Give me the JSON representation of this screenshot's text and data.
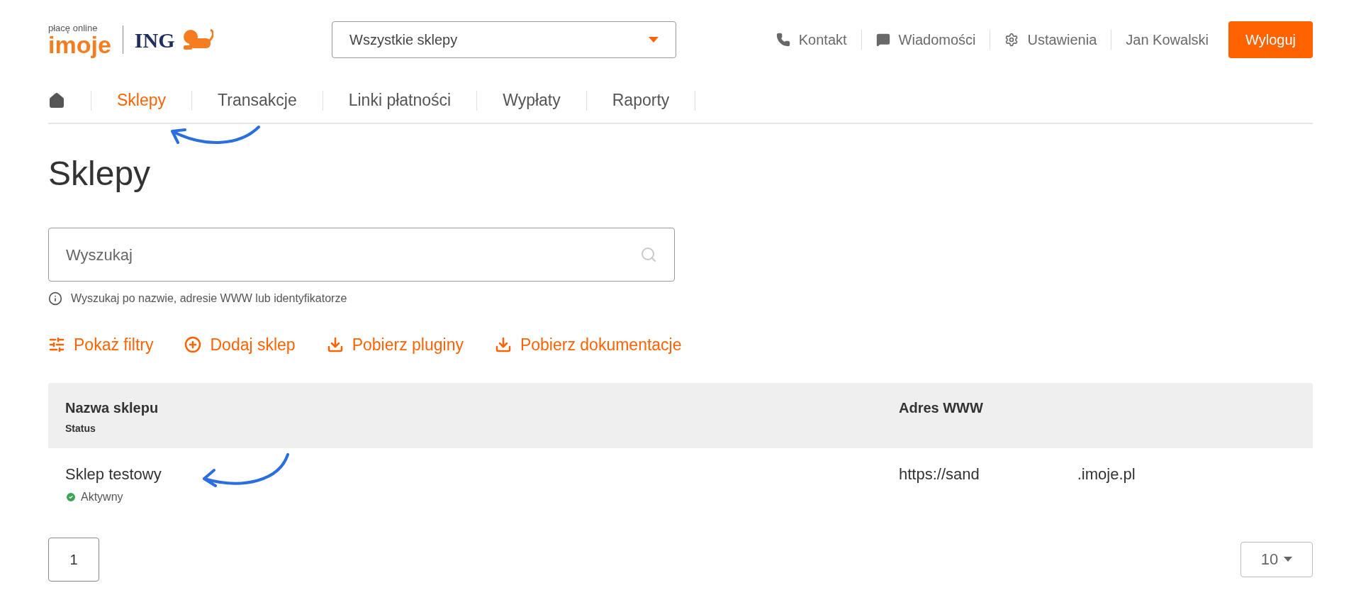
{
  "logo": {
    "tagline": "płacę online",
    "wordmark": "imoje",
    "bank": "ING"
  },
  "shop_select": {
    "value": "Wszystkie sklepy"
  },
  "top_links": [
    {
      "kind": "phone",
      "label": "Kontakt"
    },
    {
      "kind": "message",
      "label": "Wiadomości"
    },
    {
      "kind": "gear",
      "label": "Ustawienia"
    },
    {
      "kind": "user",
      "label": "Jan Kowalski"
    }
  ],
  "logout_button": "Wyloguj",
  "nav": [
    {
      "kind": "home",
      "selected": false
    },
    {
      "kind": "text",
      "label": "Sklepy",
      "selected": true
    },
    {
      "kind": "text",
      "label": "Transakcje",
      "selected": false
    },
    {
      "kind": "text",
      "label": "Linki płatności",
      "selected": false
    },
    {
      "kind": "text",
      "label": "Wypłaty",
      "selected": false
    },
    {
      "kind": "text",
      "label": "Raporty",
      "selected": false
    }
  ],
  "page_title": "Sklepy",
  "search": {
    "placeholder": "Wyszukaj",
    "hint": "Wyszukaj po nazwie, adresie WWW lub identyfikatorze"
  },
  "actions": [
    {
      "kind": "filters",
      "label": "Pokaż filtry"
    },
    {
      "kind": "add",
      "label": "Dodaj sklep"
    },
    {
      "kind": "download",
      "label": "Pobierz pluginy"
    },
    {
      "kind": "download",
      "label": "Pobierz dokumentacje"
    }
  ],
  "table": {
    "columns": [
      {
        "title": "Nazwa sklepu",
        "subtitle": "Status"
      },
      {
        "title": "Adres WWW"
      }
    ],
    "rows": [
      {
        "name": "Sklep testowy",
        "status": "Aktywny",
        "active": true,
        "url_start": "https://sand",
        "url_end": ".imoje.pl"
      }
    ]
  },
  "pagination": {
    "pages": [
      {
        "label": "1",
        "selected": true
      }
    ],
    "page_size": "10"
  }
}
